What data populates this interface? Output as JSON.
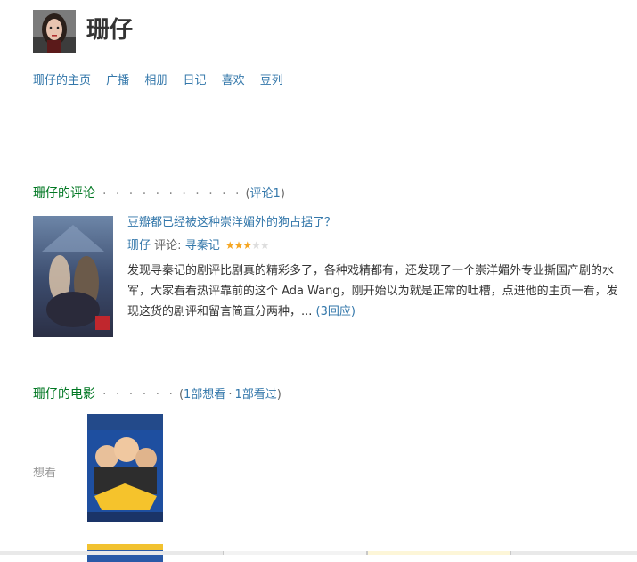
{
  "user": {
    "name": "珊仔"
  },
  "nav": [
    "珊仔的主页",
    "广播",
    "相册",
    "日记",
    "喜欢",
    "豆列"
  ],
  "reviews_section": {
    "title": "珊仔的评论",
    "dots": "· · · · · · · · · · ·",
    "open": "(",
    "count": "评论1",
    "close": ")"
  },
  "review": {
    "title": "豆瓣都已经被这种崇洋媚外的狗占据了？",
    "author": "珊仔",
    "meta_prefix": "评论:",
    "movie": "寻秦记",
    "rating": 3,
    "rating_max": 5,
    "excerpt": "发现寻秦记的剧评比剧真的精彩多了，各种戏精都有，还发现了一个崇洋媚外专业撕国产剧的水军，大家看看热评靠前的这个 Ada Wang，刚开始以为就是正常的吐槽，点进他的主页一看，发现这货的剧评和留言简直分两种，...",
    "replies": "(3回应)"
  },
  "movies_section": {
    "title": "珊仔的电影",
    "dots": "· · · · · ·",
    "open": "(",
    "wish": "1部想看",
    "sep": "·",
    "seen": "1部看过",
    "close": ")"
  },
  "movie_row": {
    "label": "想看"
  },
  "colors": {
    "link": "#3377aa",
    "section_title": "#007722",
    "star": "#f5a623"
  }
}
